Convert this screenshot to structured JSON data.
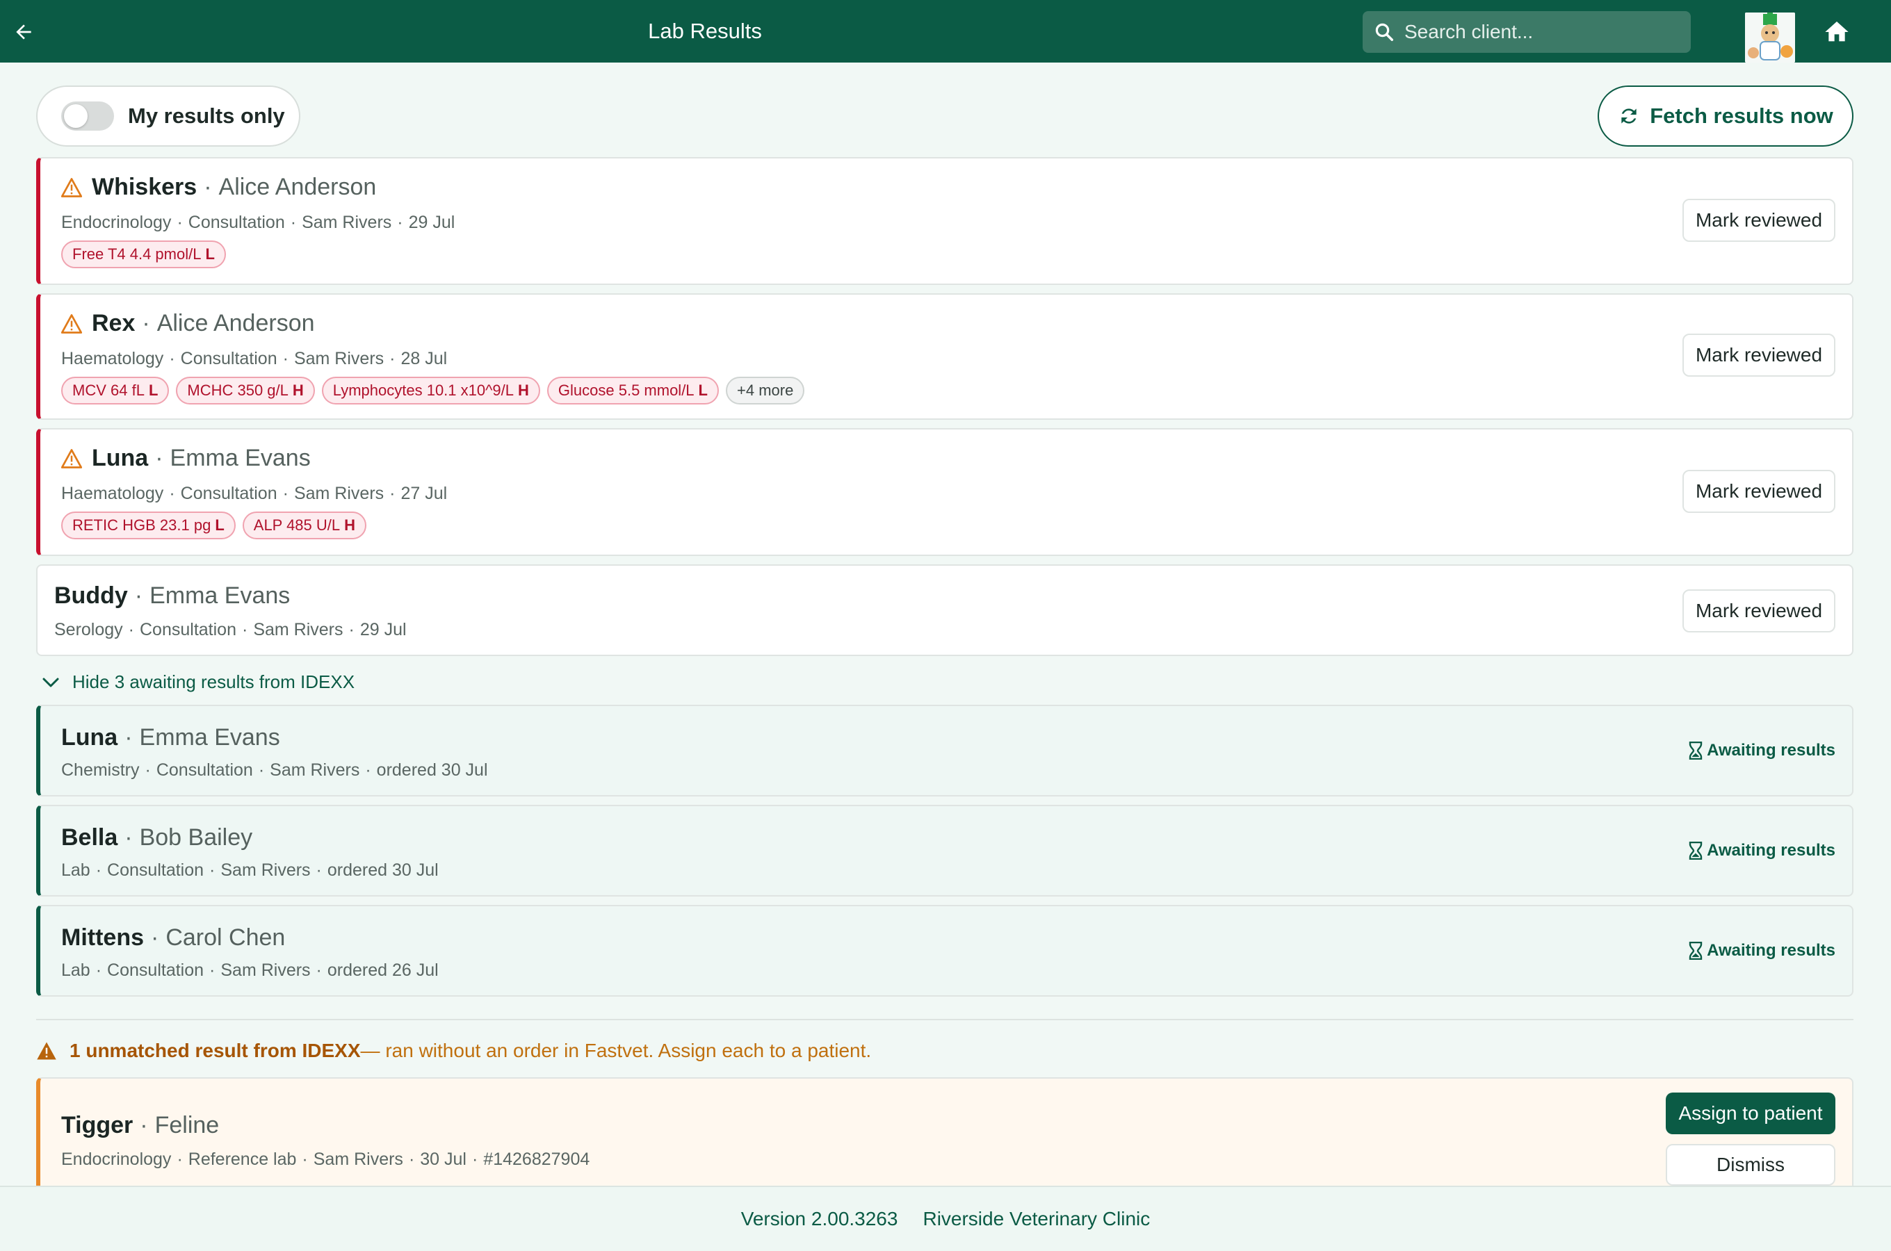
{
  "header": {
    "title": "Lab Results",
    "search_placeholder": "Search client..."
  },
  "controls": {
    "my_results_label": "My results only",
    "my_results_on": false,
    "fetch_label": "Fetch results now"
  },
  "results": [
    {
      "pet": "Whiskers",
      "owner": "Alice Anderson",
      "meta": [
        "Endocrinology",
        "Consultation",
        "Sam Rivers",
        "29 Jul"
      ],
      "flags": [
        {
          "text": "Free T4 4.4 pmol/L",
          "flag": "L"
        }
      ],
      "more": "",
      "action": "Mark reviewed"
    },
    {
      "pet": "Rex",
      "owner": "Alice Anderson",
      "meta": [
        "Haematology",
        "Consultation",
        "Sam Rivers",
        "28 Jul"
      ],
      "flags": [
        {
          "text": "MCV 64 fL",
          "flag": "L"
        },
        {
          "text": "MCHC 350 g/L",
          "flag": "H"
        },
        {
          "text": "Lymphocytes 10.1 x10^9/L",
          "flag": "H"
        },
        {
          "text": "Glucose 5.5 mmol/L",
          "flag": "L"
        }
      ],
      "more": "+4 more",
      "action": "Mark reviewed"
    },
    {
      "pet": "Luna",
      "owner": "Emma Evans",
      "meta": [
        "Haematology",
        "Consultation",
        "Sam Rivers",
        "27 Jul"
      ],
      "flags": [
        {
          "text": "RETIC HGB 23.1 pg",
          "flag": "L"
        },
        {
          "text": "ALP 485 U/L",
          "flag": "H"
        }
      ],
      "more": "",
      "action": "Mark reviewed"
    },
    {
      "pet": "Buddy",
      "owner": "Emma Evans",
      "meta": [
        "Serology",
        "Consultation",
        "Sam Rivers",
        "29 Jul"
      ],
      "flags": [],
      "more": "",
      "action": "Mark reviewed"
    }
  ],
  "awaiting_toggle": "Hide 3 awaiting results from IDEXX",
  "awaiting": [
    {
      "pet": "Luna",
      "owner": "Emma Evans",
      "meta": [
        "Chemistry",
        "Consultation",
        "Sam Rivers",
        "ordered 30 Jul"
      ],
      "status": "Awaiting results"
    },
    {
      "pet": "Bella",
      "owner": "Bob Bailey",
      "meta": [
        "Lab",
        "Consultation",
        "Sam Rivers",
        "ordered 30 Jul"
      ],
      "status": "Awaiting results"
    },
    {
      "pet": "Mittens",
      "owner": "Carol Chen",
      "meta": [
        "Lab",
        "Consultation",
        "Sam Rivers",
        "ordered 26 Jul"
      ],
      "status": "Awaiting results"
    }
  ],
  "unmatched": {
    "notice_bold": "1 unmatched result from IDEXX",
    "notice_rest": " — ran without an order in Fastvet. Assign each to a patient.",
    "items": [
      {
        "pet": "Tigger",
        "species": "Feline",
        "meta": [
          "Endocrinology",
          "Reference lab",
          "Sam Rivers",
          "30 Jul",
          "#1426827904"
        ],
        "assign_label": "Assign to patient",
        "dismiss_label": "Dismiss"
      }
    ]
  },
  "footer": {
    "version": "Version 2.00.3263",
    "clinic": "Riverside Veterinary Clinic"
  },
  "colors": {
    "brand": "#0b5b45",
    "flag_red": "#c8102e",
    "warning_orange": "#e07b1a"
  }
}
